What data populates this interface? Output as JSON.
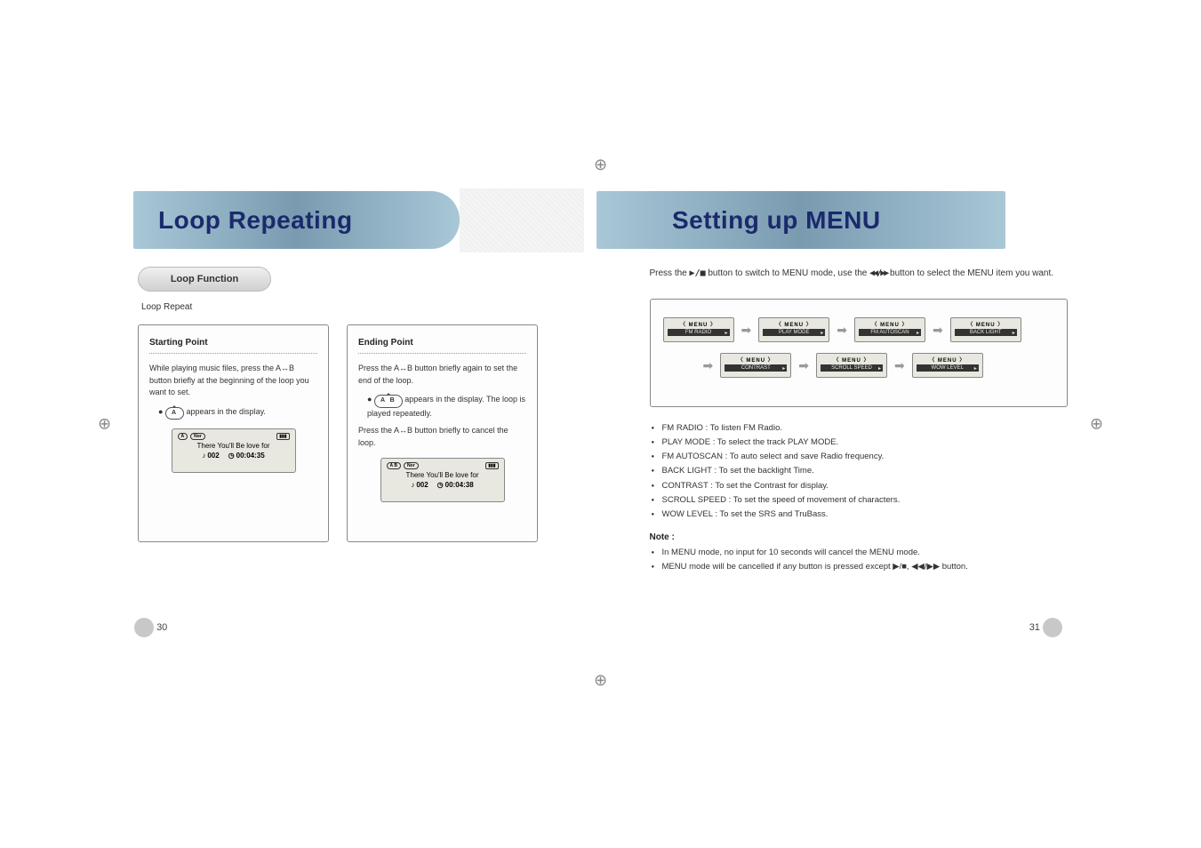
{
  "left": {
    "header_title": "Loop Repeating",
    "pill": "Loop Function",
    "subtitle": "Loop Repeat",
    "step1": {
      "label": "Starting Point",
      "text1": "While playing music files, press the A↔B button briefly at the beginning of the loop you want to set.",
      "bullet_badge": "A",
      "bullet_text": "appears in the display.",
      "lcd": {
        "ab": "A",
        "mode": "Nor",
        "song": "There You'll Be love for",
        "track": "002",
        "time": "00:04:35"
      }
    },
    "step2": {
      "label": "Ending Point",
      "text1": "Press the A↔B button briefly again to set the end of the loop.",
      "bullet_badge": "A  B",
      "bullet_text": "appears in the display. The loop is played repeatedly.",
      "text2": "Press the A↔B button briefly to cancel the loop.",
      "lcd": {
        "ab": "A  B",
        "mode": "Nor",
        "song": "There You'll Be love for",
        "track": "002",
        "time": "00:04:38"
      }
    },
    "page_num": "30"
  },
  "right": {
    "header_title": "Setting up MENU",
    "intro_prefix": "Press the",
    "intro_mid": "button to switch to MENU mode, use the",
    "intro_suffix": "button to select the MENU item you want.",
    "menus": {
      "row1": [
        "FM RADIO",
        "PLAY MODE",
        "FM AUTOSCAN",
        "BACK LIGHT"
      ],
      "row2": [
        "CONTRAST",
        "SCROLL SPEED",
        "WOW LEVEL"
      ],
      "menu_label": "〈 MENU 〉"
    },
    "bullets_main": [
      "FM RADIO : To listen FM Radio.",
      "PLAY MODE : To select the track PLAY MODE.",
      "FM AUTOSCAN : To auto select and save Radio frequency.",
      "BACK LIGHT : To set the backlight Time.",
      "CONTRAST : To set the Contrast for display.",
      "SCROLL SPEED : To set the speed of movement of characters.",
      "WOW LEVEL : To set the SRS and TruBass."
    ],
    "note_label": "Note :",
    "bullets_note": [
      "In MENU mode, no input for 10 seconds will cancel the MENU mode.",
      "MENU mode will be cancelled if any button is pressed except ▶/■, ◀◀/▶▶ button."
    ],
    "page_num": "31"
  }
}
